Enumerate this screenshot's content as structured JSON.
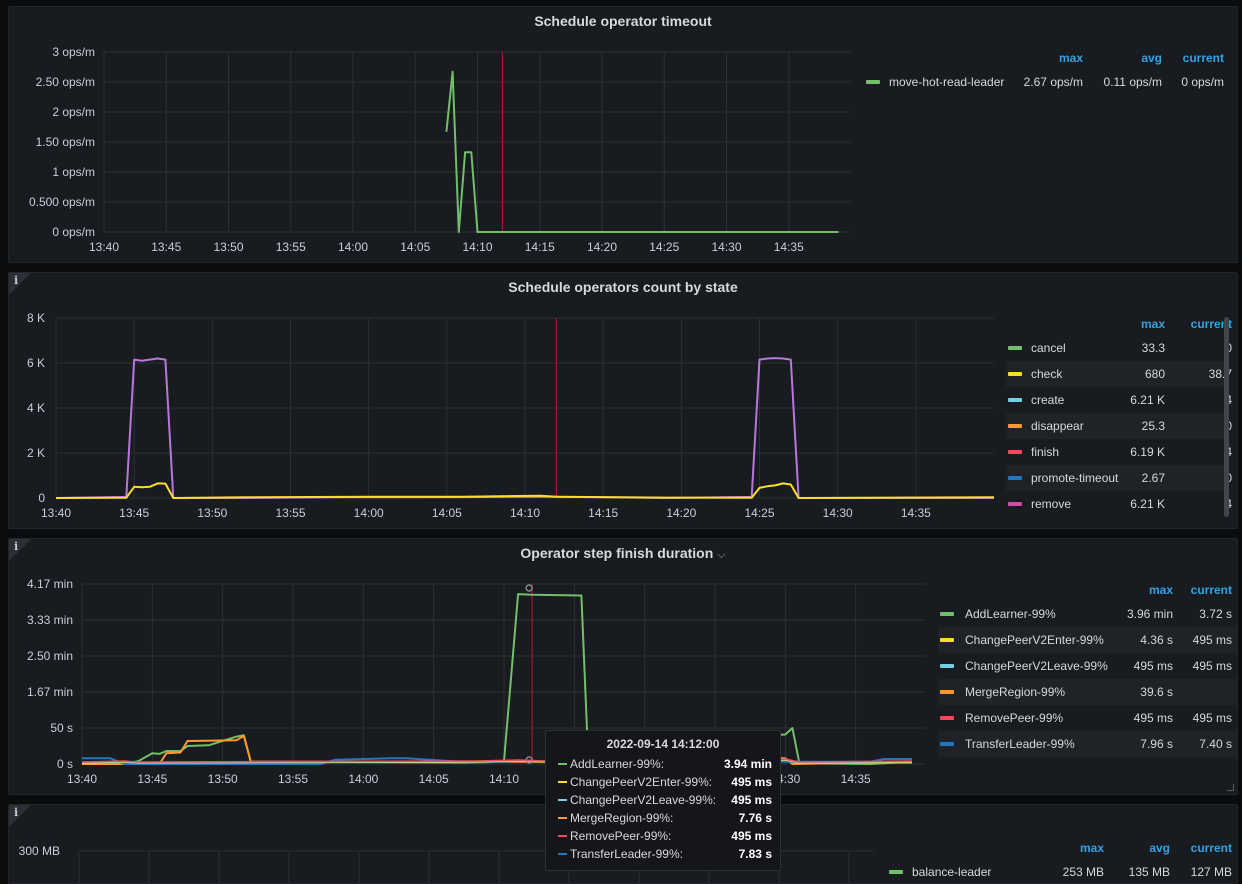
{
  "colors": {
    "green": "#73bf69",
    "yellow": "#fade2a",
    "cyan": "#5794f2",
    "teal": "#8ab8ff",
    "lightblue": "#73d0e6",
    "orange": "#ff9830",
    "red": "#f2495c",
    "blue": "#1f78c1",
    "purple": "#b877d9",
    "magenta": "#d44aa3",
    "legendHeader": "#33a2e5"
  },
  "panels": [
    {
      "title": "Schedule operator timeout",
      "legend_headers": [
        "max",
        "avg",
        "current"
      ],
      "legend": [
        {
          "name": "move-hot-read-leader",
          "color": "#73bf69",
          "values": [
            "2.67 ops/m",
            "0.11 ops/m",
            "0 ops/m"
          ]
        }
      ]
    },
    {
      "title": "Schedule operators count by state",
      "legend_headers": [
        "max",
        "current"
      ],
      "legend": [
        {
          "name": "cancel",
          "color": "#73bf69",
          "values": [
            "33.3",
            "0"
          ]
        },
        {
          "name": "check",
          "color": "#fade2a",
          "values": [
            "680",
            "38.7"
          ]
        },
        {
          "name": "create",
          "color": "#73d0e6",
          "values": [
            "6.21 K",
            "4"
          ]
        },
        {
          "name": "disappear",
          "color": "#ff9830",
          "values": [
            "25.3",
            "0"
          ]
        },
        {
          "name": "finish",
          "color": "#f2495c",
          "values": [
            "6.19 K",
            "4"
          ]
        },
        {
          "name": "promote-timeout",
          "color": "#1f78c1",
          "values": [
            "2.67",
            "0"
          ]
        },
        {
          "name": "remove",
          "color": "#d44aa3",
          "values": [
            "6.21 K",
            "4"
          ]
        }
      ]
    },
    {
      "title": "Operator step finish duration",
      "title_chevron": "⌵",
      "legend_headers": [
        "max",
        "current"
      ],
      "legend": [
        {
          "name": "AddLearner-99%",
          "color": "#73bf69",
          "values": [
            "3.96 min",
            "3.72 s"
          ]
        },
        {
          "name": "ChangePeerV2Enter-99%",
          "color": "#fade2a",
          "values": [
            "4.36 s",
            "495 ms"
          ]
        },
        {
          "name": "ChangePeerV2Leave-99%",
          "color": "#73d0e6",
          "values": [
            "495 ms",
            "495 ms"
          ]
        },
        {
          "name": "MergeRegion-99%",
          "color": "#ff9830",
          "values": [
            "39.6 s",
            ""
          ]
        },
        {
          "name": "RemovePeer-99%",
          "color": "#f2495c",
          "values": [
            "495 ms",
            "495 ms"
          ]
        },
        {
          "name": "TransferLeader-99%",
          "color": "#1f78c1",
          "values": [
            "7.96 s",
            "7.40 s"
          ]
        }
      ]
    },
    {
      "title": "",
      "legend_headers": [
        "max",
        "avg",
        "current"
      ],
      "legend": [
        {
          "name": "balance-leader",
          "color": "#73bf69",
          "values": [
            "253 MB",
            "135 MB",
            "127 MB"
          ]
        }
      ]
    }
  ],
  "tooltip": {
    "time": "2022-09-14 14:12:00",
    "rows": [
      {
        "name": "AddLearner-99%:",
        "value": "3.94 min",
        "color": "#73bf69"
      },
      {
        "name": "ChangePeerV2Enter-99%:",
        "value": "495 ms",
        "color": "#fade2a"
      },
      {
        "name": "ChangePeerV2Leave-99%:",
        "value": "495 ms",
        "color": "#73d0e6"
      },
      {
        "name": "MergeRegion-99%:",
        "value": "7.76 s",
        "color": "#ff9830"
      },
      {
        "name": "RemovePeer-99%:",
        "value": "495 ms",
        "color": "#f2495c"
      },
      {
        "name": "TransferLeader-99%:",
        "value": "7.83 s",
        "color": "#1f78c1"
      }
    ]
  },
  "chart_data": [
    {
      "type": "line",
      "title": "Schedule operator timeout",
      "x": [
        "14:07",
        "14:07:30",
        "14:08",
        "14:08:30",
        "14:09",
        "14:09:30",
        "14:10",
        "14:10:30",
        "14:15",
        "14:20",
        "14:25",
        "14:30",
        "14:35",
        "14:39"
      ],
      "x_ticks": [
        "13:40",
        "13:45",
        "13:50",
        "13:55",
        "14:00",
        "14:05",
        "14:10",
        "14:15",
        "14:20",
        "14:25",
        "14:30",
        "14:35"
      ],
      "y_ticks": [
        "0 ops/m",
        "0.500 ops/m",
        "1 ops/m",
        "1.50 ops/m",
        "2 ops/m",
        "2.50 ops/m",
        "3 ops/m"
      ],
      "ylim": [
        0,
        3
      ],
      "xlim_minutes": [
        0,
        60
      ],
      "series": [
        {
          "name": "move-hot-read-leader",
          "color": "#73bf69",
          "points": [
            [
              27.5,
              1.67
            ],
            [
              28,
              2.67
            ],
            [
              28.5,
              0
            ],
            [
              29,
              1.33
            ],
            [
              29.5,
              1.33
            ],
            [
              30,
              0
            ],
            [
              35,
              0
            ],
            [
              40,
              0
            ],
            [
              45,
              0
            ],
            [
              50,
              0
            ],
            [
              55,
              0
            ],
            [
              59,
              0
            ]
          ]
        }
      ],
      "marker_minute": 32
    },
    {
      "type": "line",
      "title": "Schedule operators count by state",
      "x_ticks": [
        "13:40",
        "13:45",
        "13:50",
        "13:55",
        "14:00",
        "14:05",
        "14:10",
        "14:15",
        "14:20",
        "14:25",
        "14:30",
        "14:35"
      ],
      "y_ticks": [
        "0",
        "2 K",
        "4 K",
        "6 K",
        "8 K"
      ],
      "ylim": [
        0,
        8000
      ],
      "xlim_minutes": [
        0,
        60
      ],
      "series": [
        {
          "name": "remove",
          "color": "#b877d9",
          "points": [
            [
              0,
              0
            ],
            [
              4.5,
              50
            ],
            [
              5,
              6150
            ],
            [
              5.5,
              6100
            ],
            [
              6,
              6150
            ],
            [
              6.5,
              6200
            ],
            [
              7,
              6150
            ],
            [
              7.5,
              0
            ],
            [
              12,
              0
            ],
            [
              18,
              30
            ],
            [
              26,
              40
            ],
            [
              32,
              60
            ],
            [
              39,
              0
            ],
            [
              44.5,
              50
            ],
            [
              45,
              6150
            ],
            [
              45.5,
              6200
            ],
            [
              46,
              6220
            ],
            [
              46.5,
              6200
            ],
            [
              47,
              6150
            ],
            [
              47.5,
              0
            ],
            [
              60,
              0
            ]
          ]
        },
        {
          "name": "check",
          "color": "#fade2a",
          "points": [
            [
              0,
              0
            ],
            [
              4.5,
              10
            ],
            [
              5,
              500
            ],
            [
              5.5,
              480
            ],
            [
              6,
              500
            ],
            [
              6.5,
              650
            ],
            [
              7,
              640
            ],
            [
              7.5,
              0
            ],
            [
              12,
              30
            ],
            [
              20,
              60
            ],
            [
              26,
              60
            ],
            [
              31,
              100
            ],
            [
              32,
              60
            ],
            [
              39,
              20
            ],
            [
              44.5,
              10
            ],
            [
              45,
              450
            ],
            [
              45.5,
              520
            ],
            [
              46,
              560
            ],
            [
              46.5,
              650
            ],
            [
              47,
              600
            ],
            [
              47.5,
              0
            ],
            [
              60,
              30
            ]
          ]
        }
      ],
      "marker_minute": 32
    },
    {
      "type": "line",
      "title": "Operator step finish duration",
      "x_ticks": [
        "13:40",
        "13:45",
        "13:50",
        "13:55",
        "14:00",
        "14:05",
        "14:10",
        "14:15",
        "14:20",
        "14:25",
        "14:30",
        "14:35"
      ],
      "y_ticks": [
        "0 s",
        "50 s",
        "1.67 min",
        "2.50 min",
        "3.33 min",
        "4.17 min"
      ],
      "ylim": [
        0,
        250
      ],
      "xlim_minutes": [
        0,
        60
      ],
      "series": [
        {
          "name": "AddLearner-99%",
          "color": "#73bf69",
          "points": [
            [
              0,
              0
            ],
            [
              3,
              0
            ],
            [
              4,
              4
            ],
            [
              5,
              15
            ],
            [
              5.5,
              14
            ],
            [
              6,
              18
            ],
            [
              7,
              18
            ],
            [
              7.5,
              25
            ],
            [
              9,
              26
            ],
            [
              11,
              38
            ],
            [
              11.5,
              40
            ],
            [
              12,
              3
            ],
            [
              14,
              3
            ],
            [
              28,
              2
            ],
            [
              30,
              4
            ],
            [
              31,
              236
            ],
            [
              32,
              235
            ],
            [
              35.5,
              234
            ],
            [
              36,
              1
            ],
            [
              48,
              2
            ],
            [
              49,
              40
            ],
            [
              50,
              41
            ],
            [
              50.5,
              50
            ],
            [
              51,
              1
            ],
            [
              56,
              0
            ],
            [
              59,
              3
            ]
          ]
        },
        {
          "name": "MergeRegion-99%",
          "color": "#ff9830",
          "points": [
            [
              0,
              0
            ],
            [
              5.5,
              0
            ],
            [
              6,
              15
            ],
            [
              7,
              16
            ],
            [
              7.5,
              32
            ],
            [
              11,
              33
            ],
            [
              11.5,
              39
            ],
            [
              12,
              3
            ],
            [
              14,
              3
            ],
            [
              31,
              3
            ],
            [
              34,
              3
            ],
            [
              48,
              8
            ],
            [
              50,
              8
            ],
            [
              50.5,
              0
            ],
            [
              56,
              2
            ],
            [
              59,
              2
            ]
          ]
        },
        {
          "name": "TransferLeader-99%",
          "color": "#1f78c1",
          "points": [
            [
              0,
              8
            ],
            [
              2,
              8
            ],
            [
              3,
              0
            ],
            [
              17,
              0
            ],
            [
              18,
              6
            ],
            [
              20,
              7
            ],
            [
              22,
              8
            ],
            [
              23,
              8
            ],
            [
              28,
              2
            ],
            [
              30,
              3
            ],
            [
              31,
              5
            ],
            [
              32,
              4
            ],
            [
              50,
              3
            ],
            [
              56,
              3
            ],
            [
              57,
              7
            ],
            [
              59,
              7
            ]
          ]
        }
      ],
      "marker_minute": 32
    },
    {
      "type": "line",
      "title": "",
      "y_ticks": [
        "300 MB"
      ],
      "series": [
        {
          "name": "balance-leader",
          "color": "#73bf69"
        }
      ]
    }
  ]
}
